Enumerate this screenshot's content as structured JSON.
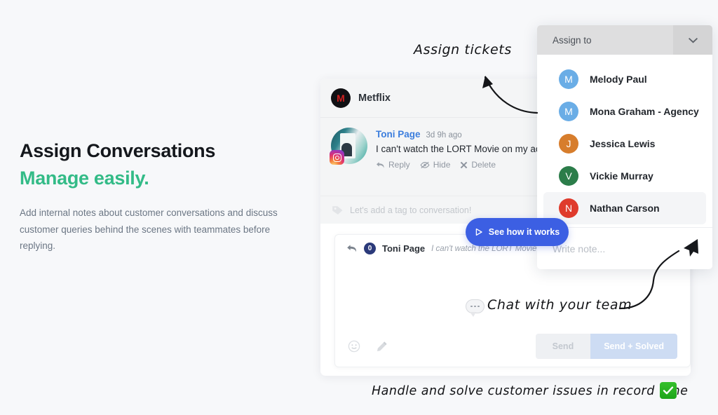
{
  "hero": {
    "title": "Assign Conversations",
    "subtitle": "Manage easily.",
    "subtitle_color": "#33bb87",
    "body": "Add internal notes about customer conversations and discuss customer queries behind the scenes with teammates before replying."
  },
  "conversation": {
    "brand": {
      "name": "Metflix",
      "avatar_letter": "M"
    },
    "message": {
      "author": "Toni Page",
      "timestamp": "3d 9h ago",
      "text": "I can't watch the LORT Movie on my ac",
      "channel_badge": "instagram-icon",
      "actions": [
        {
          "label": "Reply",
          "icon": "reply-icon"
        },
        {
          "label": "Hide",
          "icon": "hide-eye-icon"
        },
        {
          "label": "Delete",
          "icon": "close-x-icon"
        }
      ]
    },
    "tag_placeholder": "Let's add a tag to conversation!"
  },
  "composer": {
    "reply_icon": "reply-arrow-icon",
    "count_badge": "0",
    "author": "Toni Page",
    "quoted_text": "I can't watch the LORT Movie on my a",
    "tools": [
      {
        "name": "emoji-icon"
      },
      {
        "name": "pencil-icon"
      }
    ],
    "send_label": "Send",
    "send_solved_label": "Send + Solved"
  },
  "assign_panel": {
    "header": "Assign to",
    "chevron": "chevron-down-icon",
    "note_placeholder": "Write note...",
    "send_icon": "paper-plane-icon",
    "people": [
      {
        "name": "Melody Paul",
        "initial": "M",
        "color": "#6aade6",
        "selected": false
      },
      {
        "name": "Mona Graham - Agency",
        "initial": "M",
        "color": "#6aade6",
        "selected": false
      },
      {
        "name": "Jessica Lewis",
        "initial": "J",
        "color": "#d77d2c",
        "selected": false
      },
      {
        "name": "Vickie Murray",
        "initial": "V",
        "color": "#2c7d4a",
        "selected": false
      },
      {
        "name": "Nathan Carson",
        "initial": "N",
        "color": "#df3b2c",
        "selected": true
      }
    ]
  },
  "video_pill": {
    "label": "See how it works",
    "icon": "play-icon",
    "color": "#3c5fe3"
  },
  "annotations": {
    "assign_tickets": "Assign tickets",
    "chat_with_team": "Chat with your team",
    "handle_solve": "Handle and solve customer issues in record time",
    "check_icon": "green-check-icon",
    "chat_bubble_icon": "chat-bubble-icon"
  }
}
